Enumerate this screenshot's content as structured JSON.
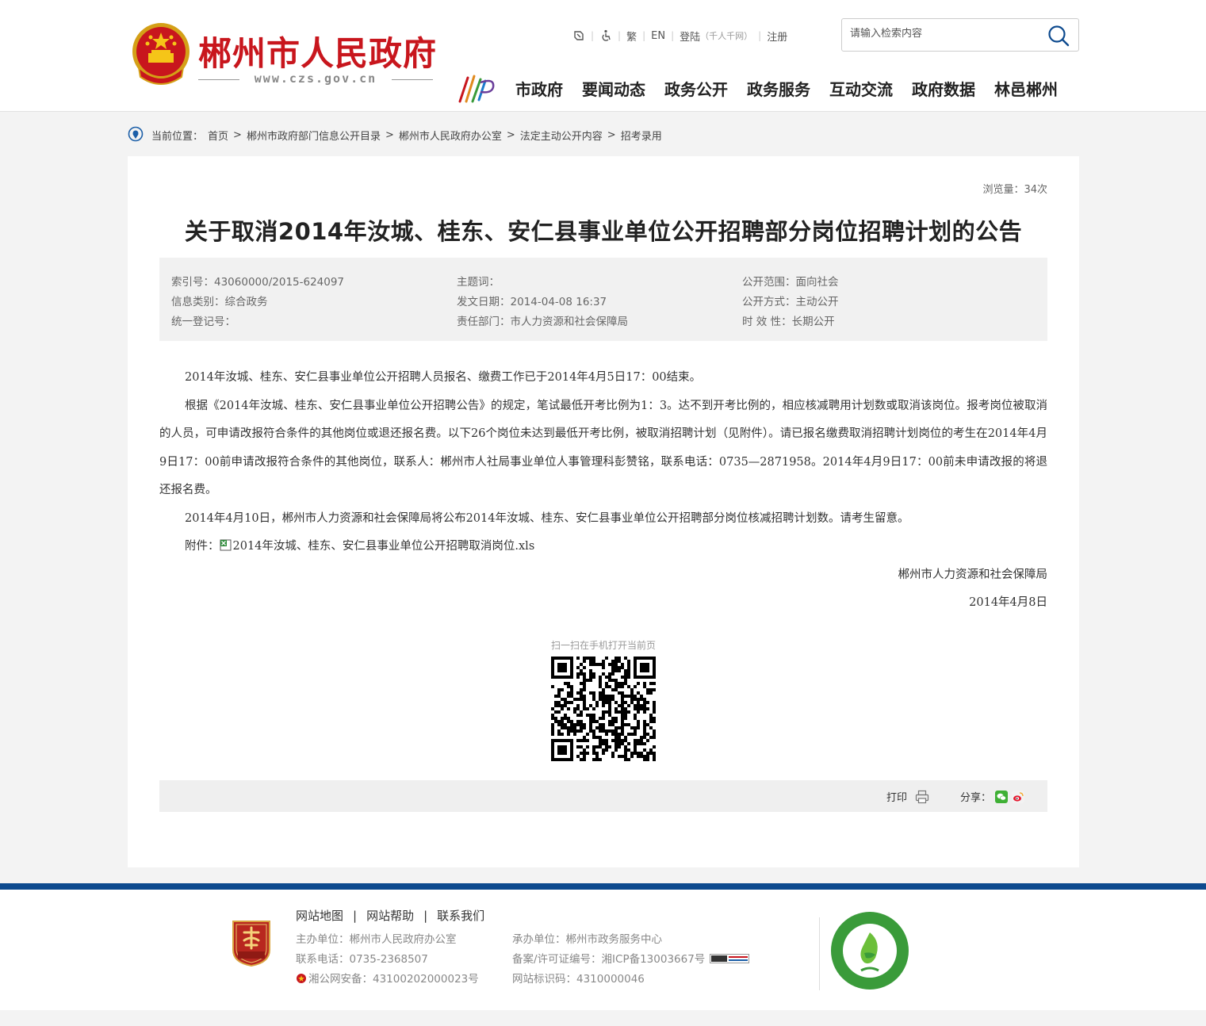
{
  "header": {
    "site_name": "郴州市人民政府",
    "site_url": "www.czs.gov.cn",
    "toolbar": {
      "traditional": "繁",
      "english": "EN",
      "login": "登陆",
      "login_note": "（千人千网）",
      "register": "注册"
    },
    "search": {
      "placeholder": "请输入检索内容"
    },
    "nav": [
      "市政府",
      "要闻动态",
      "政务公开",
      "政务服务",
      "互动交流",
      "政府数据",
      "林邑郴州"
    ]
  },
  "breadcrumb": {
    "label": "当前位置：",
    "items": [
      "首页",
      "郴州市政府部门信息公开目录",
      "郴州市人民政府办公室",
      "法定主动公开内容",
      "招考录用"
    ],
    "separator": ">"
  },
  "article": {
    "views": "浏览量：34次",
    "title": "关于取消2014年汝城、桂东、安仁县事业单位公开招聘部分岗位招聘计划的公告",
    "meta": {
      "index_no": "索引号：43060000/2015-624097",
      "topic": "主题词：",
      "scope": "公开范围：面向社会",
      "category": "信息类别：综合政务",
      "date": "发文日期：2014-04-08 16:37",
      "method": "公开方式：主动公开",
      "reg_no": "统一登记号：",
      "dept": "责任部门：市人力资源和社会保障局",
      "validity": "时 效 性：长期公开"
    },
    "paragraphs": [
      "2014年汝城、桂东、安仁县事业单位公开招聘人员报名、缴费工作已于2014年4月5日17：00结束。",
      "根据《2014年汝城、桂东、安仁县事业单位公开招聘公告》的规定，笔试最低开考比例为1：3。达不到开考比例的，相应核减聘用计划数或取消该岗位。报考岗位被取消的人员，可申请改报符合条件的其他岗位或退还报名费。以下26个岗位未达到最低开考比例，被取消招聘计划（见附件）。请已报名缴费取消招聘计划岗位的考生在2014年4月9日17：00前申请改报符合条件的其他岗位，联系人：郴州市人社局事业单位人事管理科彭赞铭，联系电话：0735—2871958。2014年4月9日17：00前未申请改报的将退还报名费。",
      "2014年4月10日，郴州市人力资源和社会保障局将公布2014年汝城、桂东、安仁县事业单位公开招聘部分岗位核减招聘计划数。请考生留意。"
    ],
    "attachment_label": "附件：",
    "attachment_name": "2014年汝城、桂东、安仁县事业单位公开招聘取消岗位.xls",
    "signature": "郴州市人力资源和社会保障局",
    "sign_date": "2014年4月8日",
    "qr_caption": "扫一扫在手机打开当前页",
    "print": "打印",
    "share": "分享："
  },
  "footer": {
    "links": [
      "网站地图",
      "网站帮助",
      "联系我们"
    ],
    "host": "主办单位：郴州市人民政府办公室",
    "phone": "联系电话：0735-2368507",
    "police": "湘公网安备：43100202000023号",
    "undertaker": "承办单位：郴州市政务服务中心",
    "icp": "备案/许可证编号：湘ICP备13003667号",
    "site_id": "网站标识码：4310000046",
    "colors": {
      "brand_red": "#c8161d",
      "footer_blue": "#0d4a8e",
      "badge_green": "#3a9b3a"
    }
  }
}
